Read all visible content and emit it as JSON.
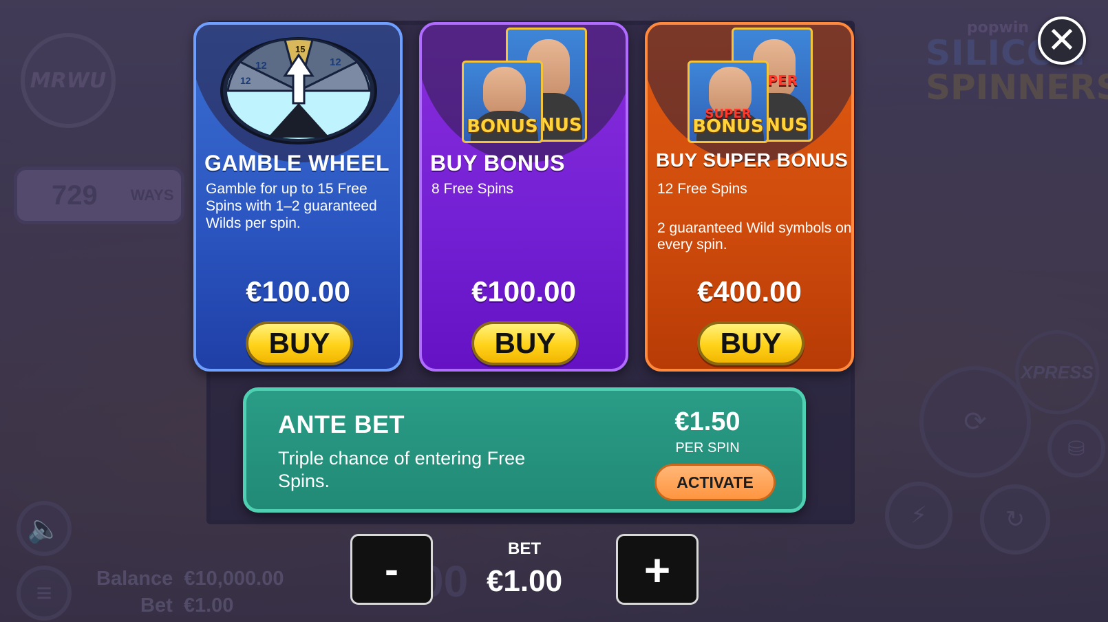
{
  "background": {
    "logo_text": "MRWU",
    "ways_value": "729",
    "ways_label": "WAYS",
    "brand_top": "popwin",
    "brand_line1": "SILICON",
    "brand_line2": "SPINNERS",
    "balance_label": "Balance",
    "balance_value": "€10,000.00",
    "bet_label": "Bet",
    "bet_value": "€1.00",
    "big_bet": "€1.00",
    "xpress_label": "XPRESS"
  },
  "cards": [
    {
      "title": "GAMBLE WHEEL",
      "description": "Gamble for up to 15 Free Spins with 1–2 guaranteed Wilds per spin.",
      "price": "€100.00",
      "button": "BUY",
      "wheel_labels": [
        "12",
        "15",
        "12",
        "12"
      ]
    },
    {
      "title": "BUY BONUS",
      "description": "8 Free Spins",
      "price": "€100.00",
      "button": "BUY",
      "tag": "BONUS"
    },
    {
      "title": "BUY SUPER BONUS",
      "description": "12 Free Spins",
      "description_extra": "2 guaranteed Wild symbols on every spin.",
      "price": "€400.00",
      "button": "BUY",
      "tag": "BONUS",
      "super_tag": "SUPER"
    }
  ],
  "ante_bet": {
    "title": "ANTE BET",
    "description": "Triple chance of entering Free Spins.",
    "price": "€1.50",
    "per_spin": "PER SPIN",
    "button": "ACTIVATE"
  },
  "bet_control": {
    "minus": "-",
    "plus": "+",
    "label": "BET",
    "value": "€1.00"
  },
  "close_label": "✕",
  "colors": {
    "gamble_card": "#2c57c2",
    "bonus_card": "#7420d4",
    "super_card": "#d04c0c",
    "ante_panel": "#218a76",
    "buy_button": "#ffd21a",
    "activate_button": "#ff9540"
  }
}
